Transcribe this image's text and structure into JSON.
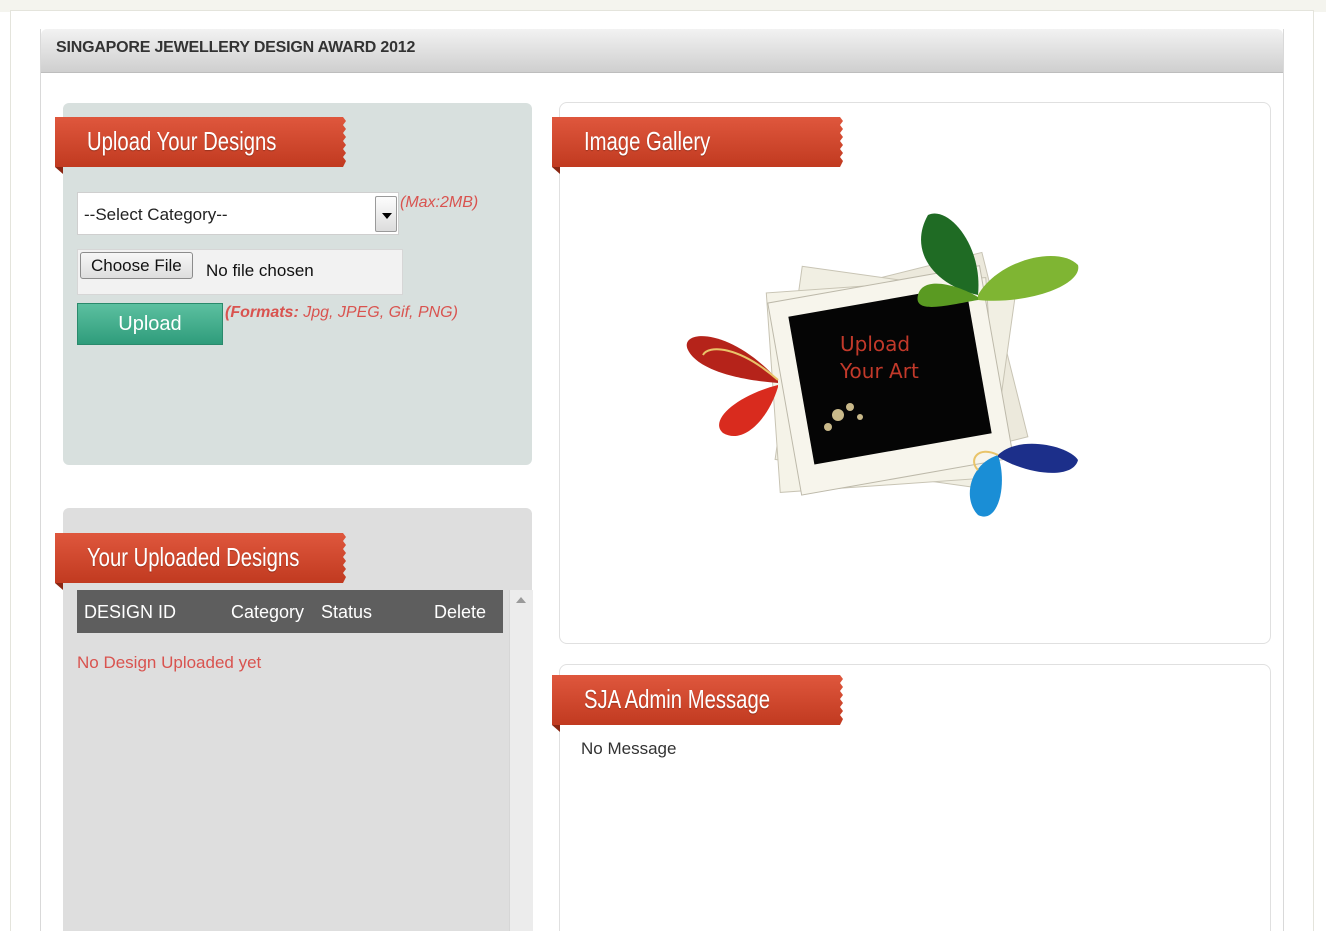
{
  "page": {
    "title": "SINGAPORE JEWELLERY DESIGN AWARD 2012"
  },
  "upload_panel": {
    "heading": "Upload Your Designs",
    "category_select": {
      "selected": "--Select Category--"
    },
    "max_size_hint": "(Max:2MB)",
    "file_input": {
      "button_label": "Choose File",
      "status": "No file chosen"
    },
    "formats_label": "(Formats:",
    "formats_list": "Jpg, JPEG, Gif, PNG)",
    "upload_button": "Upload"
  },
  "uploaded_panel": {
    "heading": "Your Uploaded Designs",
    "columns": [
      "DESIGN ID",
      "Category",
      "Status",
      "Delete"
    ],
    "empty_message": "No Design Uploaded yet"
  },
  "gallery_panel": {
    "heading": "Image Gallery",
    "artwork_caption_line1": "Upload",
    "artwork_caption_line2": "Your Art",
    "icons": [
      "butterfly-red-icon",
      "butterfly-green-icon",
      "butterfly-blue-icon",
      "photo-stack-icon"
    ]
  },
  "admin_panel": {
    "heading": "SJA Admin Message",
    "message": "No Message"
  },
  "colors": {
    "ribbon": "#d0462b",
    "upload_button": "#3fae8c",
    "hint_text": "#d9534f",
    "table_header": "#5e5e5e"
  }
}
